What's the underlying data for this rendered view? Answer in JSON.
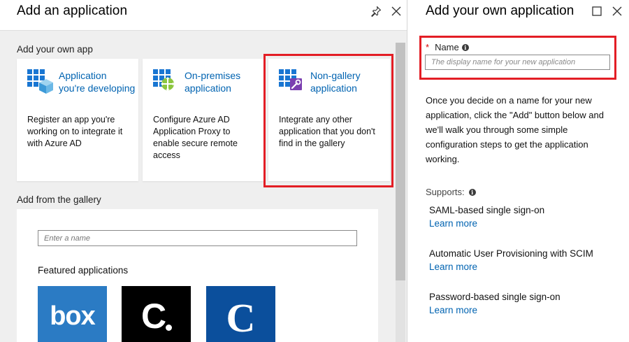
{
  "left_blade": {
    "title": "Add an application",
    "header_icons": [
      "pin-icon",
      "close-icon"
    ],
    "own_app_section": {
      "label": "Add your own app",
      "cards": [
        {
          "title": "Application you're developing",
          "description": "Register an app you're working on to integrate it with Azure AD",
          "icon": "app-grid-cube-icon"
        },
        {
          "title": "On-premises application",
          "description": "Configure Azure AD Application Proxy to enable secure remote access",
          "icon": "app-grid-proxy-icon"
        },
        {
          "title": "Non-gallery application",
          "description": "Integrate any other application that you don't find in the gallery",
          "icon": "app-grid-wrench-icon"
        }
      ]
    },
    "gallery_section": {
      "label": "Add from the gallery",
      "search_placeholder": "Enter a name",
      "featured_label": "Featured applications",
      "tiles": [
        {
          "text": "box",
          "bg": "#2b7bc4"
        },
        {
          "text": "C",
          "bg": "#000000"
        },
        {
          "text": "C",
          "bg": "#0b4f9c"
        }
      ]
    }
  },
  "right_blade": {
    "title": "Add your own application",
    "header_icons": [
      "maximize-icon",
      "close-icon"
    ],
    "name_label": "Name",
    "name_required": "*",
    "name_placeholder": "The display name for your new application",
    "description": "Once you decide on a name for your new application, click the \"Add\" button below and we'll walk you through some simple configuration steps to get the application working.",
    "supports_label": "Supports:",
    "supports": [
      {
        "name": "SAML-based single sign-on",
        "link": "Learn more"
      },
      {
        "name": "Automatic User Provisioning with SCIM",
        "link": "Learn more"
      },
      {
        "name": "Password-based single sign-on",
        "link": "Learn more"
      }
    ]
  },
  "colors": {
    "accent_link": "#0063b1",
    "highlight": "#e31e25",
    "panel_bg": "#efefef"
  }
}
